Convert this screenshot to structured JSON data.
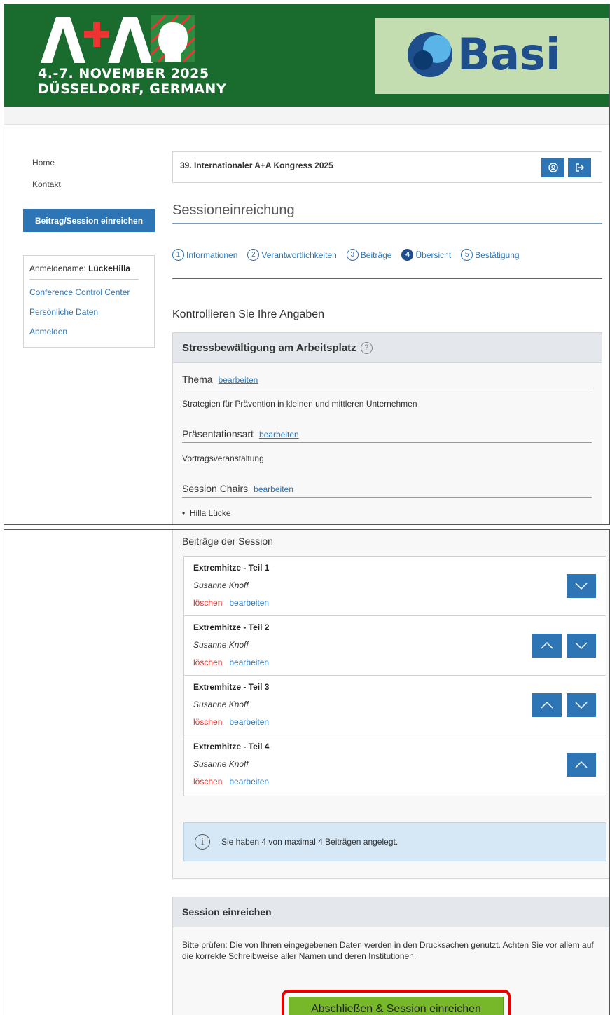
{
  "colors": {
    "banner_green": "#1a6b2e",
    "primary_blue": "#2e75b5",
    "delete_red": "#d9342b",
    "submit_green": "#77b82a",
    "highlight_red": "#e60000"
  },
  "banner": {
    "event_logo_text": "A+A",
    "date": "4.-7. NOVEMBER 2025",
    "location": "DÜSSELDORF, GERMANY",
    "sponsor_name": "Basi"
  },
  "sidebar": {
    "home": "Home",
    "kontakt": "Kontakt",
    "submit_button": "Beitrag/Session einreichen",
    "login_label": "Anmeldename:",
    "login_name": "LückeHilla",
    "links": [
      "Conference Control Center",
      "Persönliche Daten",
      "Abmelden"
    ]
  },
  "header": {
    "kongress_title": "39. Internationaler A+A Kongress 2025",
    "icons": [
      "user-icon",
      "logout-icon"
    ]
  },
  "page_title": "Sessioneinreichung",
  "steps": [
    {
      "num": "1",
      "label": "Informationen"
    },
    {
      "num": "2",
      "label": "Verantwortlichkeiten"
    },
    {
      "num": "3",
      "label": "Beiträge"
    },
    {
      "num": "4",
      "label": "Übersicht",
      "active": true
    },
    {
      "num": "5",
      "label": "Bestätigung"
    }
  ],
  "review": {
    "heading": "Kontrollieren Sie Ihre Angaben",
    "session_title": "Stressbewältigung am Arbeitsplatz",
    "edit_label": "bearbeiten",
    "thema_label": "Thema",
    "thema_value": "Strategien für Prävention in kleinen und mittleren Unternehmen",
    "praesentation_label": "Präsentationsart",
    "praesentation_value": "Vortragsveranstaltung",
    "chairs_label": "Session Chairs",
    "chairs": [
      "Hilla Lücke"
    ]
  },
  "beitraege": {
    "heading": "Beiträge der Session",
    "delete_label": "löschen",
    "edit_label": "bearbeiten",
    "items": [
      {
        "title": "Extremhitze - Teil 1",
        "author": "Susanne Knoff"
      },
      {
        "title": "Extremhitze - Teil 2",
        "author": "Susanne Knoff"
      },
      {
        "title": "Extremhitze - Teil 3",
        "author": "Susanne Knoff"
      },
      {
        "title": "Extremhitze - Teil 4",
        "author": "Susanne Knoff"
      }
    ],
    "info": "Sie haben 4 von maximal 4 Beiträgen angelegt."
  },
  "submit": {
    "heading": "Session einreichen",
    "text": "Bitte prüfen: Die von Ihnen eingegebenen Daten werden in den Drucksachen genutzt. Achten Sie vor allem auf die korrekte Schreibweise aller Namen und deren Institutionen.",
    "button": "Abschließen & Session einreichen"
  }
}
